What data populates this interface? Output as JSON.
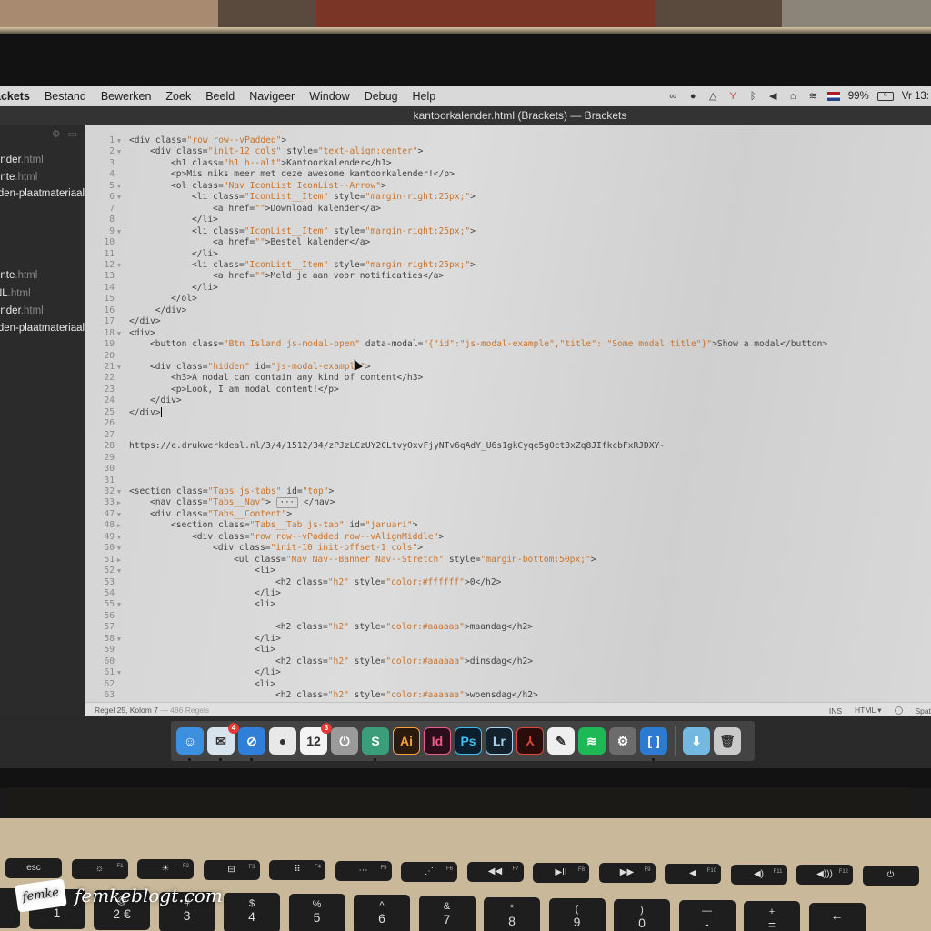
{
  "menubar": {
    "app_name": "ackets",
    "items": [
      "Bestand",
      "Bewerken",
      "Zoek",
      "Beeld",
      "Navigeer",
      "Window",
      "Debug",
      "Help"
    ],
    "status": {
      "battery": "99%",
      "clock": "Vr 13:"
    },
    "status_icons": [
      "creative-cloud-icon",
      "vpn-icon",
      "google-drive-icon",
      "antenna-icon",
      "bluetooth-icon",
      "volume-icon",
      "home-icon",
      "wifi-icon",
      "flag-nl-icon",
      "battery-icon"
    ]
  },
  "window": {
    "title": "kantoorkalender.html (Brackets) — Brackets"
  },
  "sidebar": {
    "files": [
      {
        "name": "ender",
        "ext": ".html"
      },
      {
        "name": "ente",
        "ext": ".html"
      },
      {
        "name": "rden-plaatmateriaal",
        "ext": ""
      },
      {
        "name": "ente",
        "ext": ".html"
      },
      {
        "name": "NL",
        "ext": ".html"
      },
      {
        "name": "ender",
        "ext": ".html"
      },
      {
        "name": "rden-plaatmateriaal.",
        "ext": ""
      }
    ]
  },
  "editor": {
    "lines": [
      {
        "n": "1",
        "fold": "▼",
        "indent": 0,
        "parts": [
          [
            "c",
            "<div class="
          ],
          [
            "s",
            "\"row row--vPadded\""
          ],
          [
            "c",
            ">"
          ]
        ]
      },
      {
        "n": "2",
        "fold": "▼",
        "indent": 1,
        "parts": [
          [
            "c",
            "<div class="
          ],
          [
            "s",
            "\"init-12 cols\""
          ],
          [
            "c",
            " style="
          ],
          [
            "s",
            "\"text-align:center\""
          ],
          [
            "c",
            ">"
          ]
        ]
      },
      {
        "n": "3",
        "fold": "",
        "indent": 2,
        "parts": [
          [
            "c",
            "<h1 class="
          ],
          [
            "s",
            "\"h1 h--alt\""
          ],
          [
            "c",
            ">Kantoorkalender</h1>"
          ]
        ]
      },
      {
        "n": "4",
        "fold": "",
        "indent": 2,
        "parts": [
          [
            "c",
            "<p>Mis niks meer met deze awesome kantoorkalender!</p>"
          ]
        ]
      },
      {
        "n": "5",
        "fold": "▼",
        "indent": 2,
        "parts": [
          [
            "c",
            "<ol class="
          ],
          [
            "s",
            "\"Nav IconList IconList--Arrow\""
          ],
          [
            "c",
            ">"
          ]
        ]
      },
      {
        "n": "6",
        "fold": "▼",
        "indent": 3,
        "parts": [
          [
            "c",
            "<li class="
          ],
          [
            "s",
            "\"IconList__Item\""
          ],
          [
            "c",
            " style="
          ],
          [
            "s",
            "\"margin-right:25px;\""
          ],
          [
            "c",
            ">"
          ]
        ]
      },
      {
        "n": "7",
        "fold": "",
        "indent": 4,
        "parts": [
          [
            "c",
            "<a href="
          ],
          [
            "s",
            "\"\""
          ],
          [
            "c",
            ">Download kalender</a>"
          ]
        ]
      },
      {
        "n": "8",
        "fold": "",
        "indent": 3,
        "parts": [
          [
            "c",
            "</li>"
          ]
        ]
      },
      {
        "n": "9",
        "fold": "▼",
        "indent": 3,
        "parts": [
          [
            "c",
            "<li class="
          ],
          [
            "s",
            "\"IconList__Item\""
          ],
          [
            "c",
            " style="
          ],
          [
            "s",
            "\"margin-right:25px;\""
          ],
          [
            "c",
            ">"
          ]
        ]
      },
      {
        "n": "10",
        "fold": "",
        "indent": 4,
        "parts": [
          [
            "c",
            "<a href="
          ],
          [
            "s",
            "\"\""
          ],
          [
            "c",
            ">Bestel kalender</a>"
          ]
        ]
      },
      {
        "n": "11",
        "fold": "",
        "indent": 3,
        "parts": [
          [
            "c",
            "</li>"
          ]
        ]
      },
      {
        "n": "12",
        "fold": "▼",
        "indent": 3,
        "parts": [
          [
            "c",
            "<li class="
          ],
          [
            "s",
            "\"IconList__Item\""
          ],
          [
            "c",
            " style="
          ],
          [
            "s",
            "\"margin-right:25px;\""
          ],
          [
            "c",
            ">"
          ]
        ]
      },
      {
        "n": "13",
        "fold": "",
        "indent": 4,
        "parts": [
          [
            "c",
            "<a href="
          ],
          [
            "s",
            "\"\""
          ],
          [
            "c",
            ">Meld je aan voor notificaties</a>"
          ]
        ]
      },
      {
        "n": "14",
        "fold": "",
        "indent": 3,
        "parts": [
          [
            "c",
            "</li>"
          ]
        ]
      },
      {
        "n": "15",
        "fold": "",
        "indent": 2,
        "parts": [
          [
            "c",
            "</ol>"
          ]
        ]
      },
      {
        "n": "16",
        "fold": "",
        "indent": 1,
        "parts": [
          [
            "c",
            " </div>"
          ]
        ]
      },
      {
        "n": "17",
        "fold": "",
        "indent": 0,
        "parts": [
          [
            "c",
            "</div>"
          ]
        ]
      },
      {
        "n": "18",
        "fold": "▼",
        "indent": 0,
        "parts": [
          [
            "c",
            "<div>"
          ]
        ]
      },
      {
        "n": "19",
        "fold": "",
        "indent": 1,
        "parts": [
          [
            "c",
            "<button class="
          ],
          [
            "s",
            "\"Btn Island js-modal-open\""
          ],
          [
            "c",
            " data-modal="
          ],
          [
            "s",
            "\"{\"id\":\"js-modal-example\",\"title\": \"Some modal title\"}\""
          ],
          [
            "c",
            ">Show a modal</button>"
          ]
        ]
      },
      {
        "n": "20",
        "fold": "",
        "indent": 0,
        "parts": []
      },
      {
        "n": "21",
        "fold": "▼",
        "indent": 1,
        "parts": [
          [
            "c",
            "<div class="
          ],
          [
            "s",
            "\"hidden\""
          ],
          [
            "c",
            " id="
          ],
          [
            "s",
            "\"js-modal-example\""
          ],
          [
            "c",
            ">"
          ]
        ]
      },
      {
        "n": "22",
        "fold": "",
        "indent": 2,
        "parts": [
          [
            "c",
            "<h3>A modal can contain any kind of content</h3>"
          ]
        ]
      },
      {
        "n": "23",
        "fold": "",
        "indent": 2,
        "parts": [
          [
            "c",
            "<p>Look, I am modal content!</p>"
          ]
        ]
      },
      {
        "n": "24",
        "fold": "",
        "indent": 1,
        "parts": [
          [
            "c",
            "</div>"
          ]
        ]
      },
      {
        "n": "25",
        "fold": "",
        "indent": 0,
        "parts": [
          [
            "c",
            "</div>"
          ]
        ],
        "cursor": true
      },
      {
        "n": "26",
        "fold": "",
        "indent": 0,
        "parts": []
      },
      {
        "n": "27",
        "fold": "",
        "indent": 0,
        "parts": []
      },
      {
        "n": "28",
        "fold": "",
        "indent": 0,
        "parts": [
          [
            "c",
            "https://e.drukwerkdeal.nl/3/4/1512/34/zPJzLCzUY2CLtvyOxvFjyNTv6qAdY_U6s1gkCyqe5g0ct3xZq8JIfkcbFxRJDXY-"
          ]
        ]
      },
      {
        "n": "29",
        "fold": "",
        "indent": 0,
        "parts": []
      },
      {
        "n": "30",
        "fold": "",
        "indent": 0,
        "parts": []
      },
      {
        "n": "31",
        "fold": "",
        "indent": 0,
        "parts": []
      },
      {
        "n": "32",
        "fold": "▼",
        "indent": 0,
        "parts": [
          [
            "c",
            "<section class="
          ],
          [
            "s",
            "\"Tabs js-tabs\""
          ],
          [
            "c",
            " id="
          ],
          [
            "s",
            "\"top\""
          ],
          [
            "c",
            ">"
          ]
        ]
      },
      {
        "n": "33",
        "fold": "▶",
        "indent": 1,
        "parts": [
          [
            "c",
            "<nav class="
          ],
          [
            "s",
            "\"Tabs__Nav\""
          ],
          [
            "c",
            ">"
          ]
        ],
        "collapsed": "···",
        "after": " </nav>"
      },
      {
        "n": "47",
        "fold": "▼",
        "indent": 1,
        "parts": [
          [
            "c",
            "<div class="
          ],
          [
            "s",
            "\"Tabs__Content\""
          ],
          [
            "c",
            ">"
          ]
        ]
      },
      {
        "n": "48",
        "fold": "▶",
        "indent": 2,
        "parts": [
          [
            "c",
            "<section class="
          ],
          [
            "s",
            "\"Tabs__Tab js-tab\""
          ],
          [
            "c",
            " id="
          ],
          [
            "s",
            "\"januari\""
          ],
          [
            "c",
            ">"
          ]
        ]
      },
      {
        "n": "49",
        "fold": "▼",
        "indent": 3,
        "parts": [
          [
            "c",
            "<div class="
          ],
          [
            "s",
            "\"row row--vPadded row--vAlignMiddle\""
          ],
          [
            "c",
            ">"
          ]
        ]
      },
      {
        "n": "50",
        "fold": "▼",
        "indent": 4,
        "parts": [
          [
            "c",
            "<div class="
          ],
          [
            "s",
            "\"init-10 init-offset-1 cols\""
          ],
          [
            "c",
            ">"
          ]
        ]
      },
      {
        "n": "51",
        "fold": "▶",
        "indent": 5,
        "parts": [
          [
            "c",
            "<ul class="
          ],
          [
            "s",
            "\"Nav Nav--Banner Nav--Stretch\""
          ],
          [
            "c",
            " style="
          ],
          [
            "s",
            "\"margin-bottom:50px;\""
          ],
          [
            "c",
            ">"
          ]
        ]
      },
      {
        "n": "52",
        "fold": "▼",
        "indent": 6,
        "parts": [
          [
            "c",
            "<li>"
          ]
        ]
      },
      {
        "n": "53",
        "fold": "",
        "indent": 7,
        "parts": [
          [
            "c",
            "<h2 class="
          ],
          [
            "s",
            "\"h2\""
          ],
          [
            "c",
            " style="
          ],
          [
            "s",
            "\"color:#ffffff\""
          ],
          [
            "c",
            ">0</h2>"
          ]
        ]
      },
      {
        "n": "54",
        "fold": "",
        "indent": 6,
        "parts": [
          [
            "c",
            "</li>"
          ]
        ]
      },
      {
        "n": "55",
        "fold": "▼",
        "indent": 6,
        "parts": [
          [
            "c",
            "<li>"
          ]
        ]
      },
      {
        "n": "56",
        "fold": "",
        "indent": 7,
        "parts": []
      },
      {
        "n": "57",
        "fold": "",
        "indent": 7,
        "parts": [
          [
            "c",
            "<h2 class="
          ],
          [
            "s",
            "\"h2\""
          ],
          [
            "c",
            " style="
          ],
          [
            "s",
            "\"color:#aaaaaa\""
          ],
          [
            "c",
            ">maandag</h2>"
          ]
        ]
      },
      {
        "n": "58",
        "fold": "▼",
        "indent": 6,
        "parts": [
          [
            "c",
            "</li>"
          ]
        ]
      },
      {
        "n": "59",
        "fold": "",
        "indent": 6,
        "parts": [
          [
            "c",
            "<li>"
          ]
        ]
      },
      {
        "n": "60",
        "fold": "",
        "indent": 7,
        "parts": [
          [
            "c",
            "<h2 class="
          ],
          [
            "s",
            "\"h2\""
          ],
          [
            "c",
            " style="
          ],
          [
            "s",
            "\"color:#aaaaaa\""
          ],
          [
            "c",
            ">dinsdag</h2>"
          ]
        ]
      },
      {
        "n": "61",
        "fold": "▼",
        "indent": 6,
        "parts": [
          [
            "c",
            "</li>"
          ]
        ]
      },
      {
        "n": "62",
        "fold": "",
        "indent": 6,
        "parts": [
          [
            "c",
            "<li>"
          ]
        ]
      },
      {
        "n": "63",
        "fold": "",
        "indent": 7,
        "parts": [
          [
            "c",
            "<h2 class="
          ],
          [
            "s",
            "\"h2\""
          ],
          [
            "c",
            " style="
          ],
          [
            "s",
            "\"color:#aaaaaa\""
          ],
          [
            "c",
            ">woensdag</h2>"
          ]
        ]
      },
      {
        "n": "64",
        "fold": "▼",
        "indent": 6,
        "parts": [
          [
            "c",
            "</li>"
          ]
        ]
      }
    ],
    "string_color": "#c8752f"
  },
  "statusbar": {
    "position": "Regel 25, Kolom 7",
    "line_count": "— 486 Regels",
    "mode": "INS",
    "language": "HTML ▾",
    "spaces": "Spat"
  },
  "dock": {
    "apps": [
      {
        "name": "finder",
        "label": "☺",
        "bg": "#3d8fe0",
        "running": true
      },
      {
        "name": "mail",
        "label": "✉",
        "bg": "#d7e4ee",
        "badge": "4",
        "running": true
      },
      {
        "name": "safari",
        "label": "⊘",
        "bg": "#2f7fd8",
        "running": true
      },
      {
        "name": "chrome",
        "label": "●",
        "bg": "#e8e8e8"
      },
      {
        "name": "calendar",
        "label": "12",
        "bg": "#f4f4f4",
        "badge": "3"
      },
      {
        "name": "power-app",
        "label": "⏻",
        "bg": "#9a9a9a"
      },
      {
        "name": "slack",
        "label": "S",
        "bg": "#3b9e7b",
        "running": true
      },
      {
        "name": "illustrator",
        "label": "Ai",
        "bg": "#2b1a0e"
      },
      {
        "name": "indesign",
        "label": "Id",
        "bg": "#2b0e1a"
      },
      {
        "name": "photoshop",
        "label": "Ps",
        "bg": "#0b1e2e"
      },
      {
        "name": "lightroom",
        "label": "Lr",
        "bg": "#13212c"
      },
      {
        "name": "acrobat",
        "label": "⅄",
        "bg": "#2a0d0b"
      },
      {
        "name": "textedit",
        "label": "✎",
        "bg": "#efefef"
      },
      {
        "name": "spotify",
        "label": "≋",
        "bg": "#1db954"
      },
      {
        "name": "system-preferences",
        "label": "⚙",
        "bg": "#6c6c6c"
      },
      {
        "name": "brackets",
        "label": "[ ]",
        "bg": "#2c7bd1",
        "running": true
      },
      {
        "name": "downloads-folder",
        "label": "⬇",
        "bg": "#73b8e0"
      },
      {
        "name": "trash",
        "label": "🗑",
        "bg": "#c9c9c9"
      }
    ]
  },
  "keyboard": {
    "fn_row": [
      {
        "label": "esc",
        "fn": ""
      },
      {
        "label": "☼",
        "fn": "F1"
      },
      {
        "label": "☀",
        "fn": "F2"
      },
      {
        "label": "⊟",
        "fn": "F3"
      },
      {
        "label": "⠿",
        "fn": "F4"
      },
      {
        "label": "⋯",
        "fn": "F5"
      },
      {
        "label": "⋰",
        "fn": "F6"
      },
      {
        "label": "◀◀",
        "fn": "F7"
      },
      {
        "label": "▶II",
        "fn": "F8"
      },
      {
        "label": "▶▶",
        "fn": "F9"
      },
      {
        "label": "◀",
        "fn": "F10"
      },
      {
        "label": "◀)",
        "fn": "F11"
      },
      {
        "label": "◀)))",
        "fn": "F12"
      },
      {
        "label": "⏻",
        "fn": ""
      }
    ],
    "num_row": [
      {
        "top": "±",
        "bot": "§"
      },
      {
        "top": "!",
        "bot": "1"
      },
      {
        "top": "@",
        "bot": "2 €"
      },
      {
        "top": "#",
        "bot": "3"
      },
      {
        "top": "$",
        "bot": "4"
      },
      {
        "top": "%",
        "bot": "5"
      },
      {
        "top": "^",
        "bot": "6"
      },
      {
        "top": "&",
        "bot": "7"
      },
      {
        "top": "*",
        "bot": "8"
      },
      {
        "top": "(",
        "bot": "9"
      },
      {
        "top": ")",
        "bot": "0"
      },
      {
        "top": "—",
        "bot": "-"
      },
      {
        "top": "+",
        "bot": "="
      },
      {
        "top": "",
        "bot": "←"
      }
    ]
  },
  "watermark": {
    "logo": "femke",
    "text": "femkeblogt.com"
  }
}
